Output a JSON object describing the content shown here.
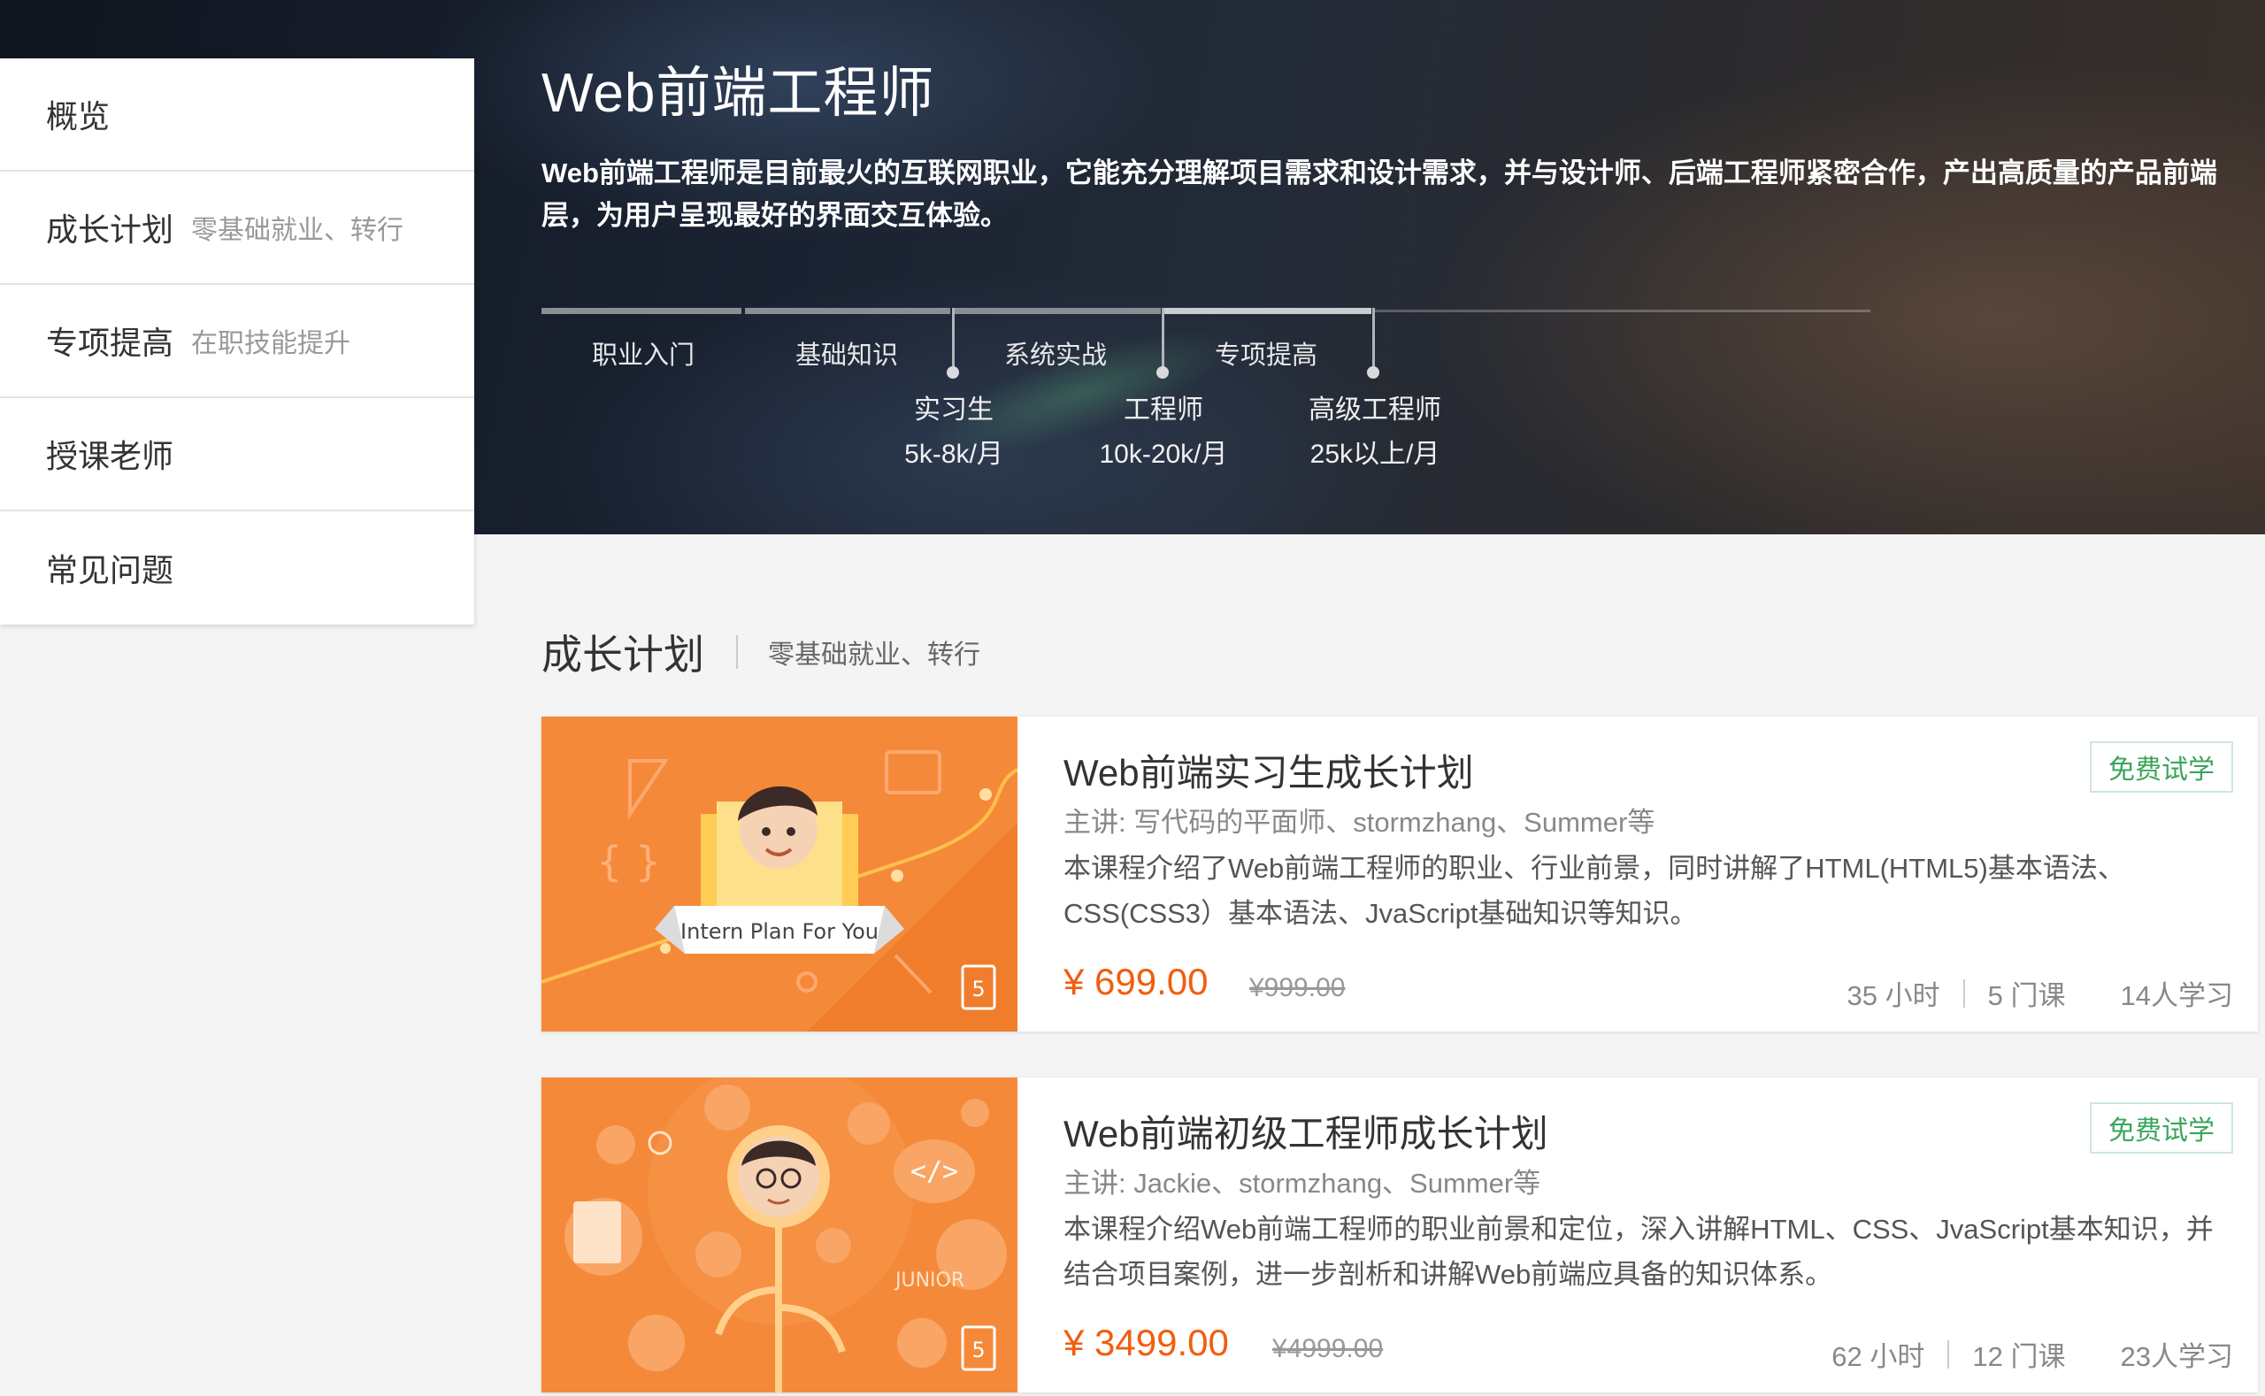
{
  "hero": {
    "title": "Web前端工程师",
    "description": "Web前端工程师是目前最火的互联网职业，它能充分理解项目需求和设计需求，并与设计师、后端工程师紧密合作，产出高质量的产品前端层，为用户呈现最好的界面交互体验。",
    "stages": [
      "职业入门",
      "基础知识",
      "系统实战",
      "专项提高"
    ],
    "levels": [
      {
        "role": "实习生",
        "salary": "5k-8k/月"
      },
      {
        "role": "工程师",
        "salary": "10k-20k/月"
      },
      {
        "role": "高级工程师",
        "salary": "25k以上/月"
      }
    ]
  },
  "sidebar": {
    "items": [
      {
        "label": "概览",
        "sub": ""
      },
      {
        "label": "成长计划",
        "sub": "零基础就业、转行"
      },
      {
        "label": "专项提高",
        "sub": "在职技能提升"
      },
      {
        "label": "授课老师",
        "sub": ""
      },
      {
        "label": "常见问题",
        "sub": ""
      }
    ]
  },
  "section": {
    "title": "成长计划",
    "subtitle": "零基础就业、转行"
  },
  "courses": [
    {
      "title": "Web前端实习生成长计划",
      "teacher": "主讲: 写代码的平面师、stormzhang、Summer等",
      "description": "本课程介绍了Web前端工程师的职业、行业前景，同时讲解了HTML(HTML5)基本语法、CSS(CSS3）基本语法、JvaScript基础知识等知识。",
      "price": "¥ 699.00",
      "old_price": "¥999.00",
      "hours": "35 小时",
      "lessons": "5 门课",
      "students": "14人学习",
      "badge": "免费试学",
      "thumb_text": "Intern Plan For You",
      "thumb_badge": "HTML"
    },
    {
      "title": "Web前端初级工程师成长计划",
      "teacher": "主讲: Jackie、stormzhang、Summer等",
      "description": "本课程介绍Web前端工程师的职业前景和定位，深入讲解HTML、CSS、JvaScript基本知识，并结合项目案例，进一步剖析和讲解Web前端应具备的知识体系。",
      "price": "¥ 3499.00",
      "old_price": "¥4999.00",
      "hours": "62 小时",
      "lessons": "12 门课",
      "students": "23人学习",
      "badge": "免费试学",
      "thumb_text": "JUNIOR",
      "thumb_badge": "HTML"
    }
  ],
  "colors": {
    "accent_orange": "#f25d0e",
    "trial_green": "#3aa55a",
    "thumb_orange": "#f5893a"
  }
}
